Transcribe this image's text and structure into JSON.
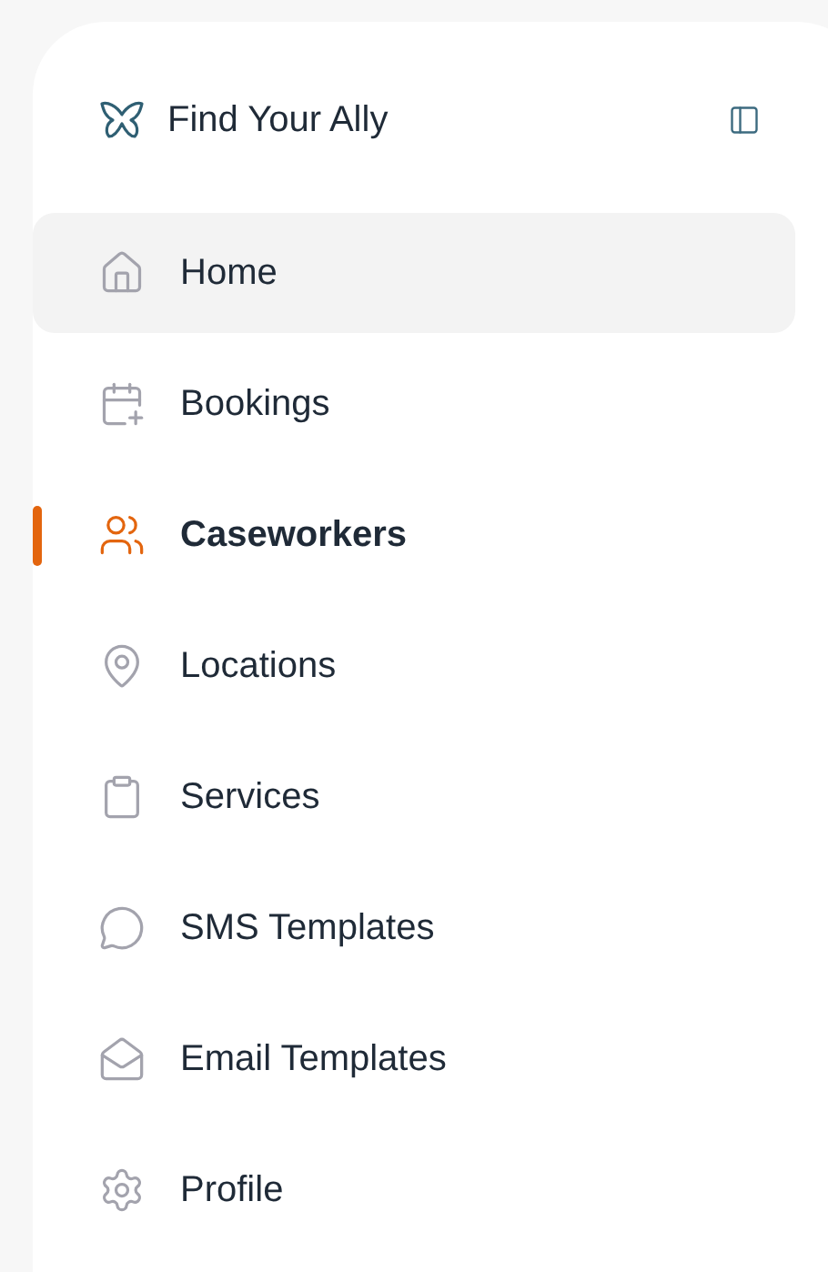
{
  "brand": {
    "title": "Find Your Ally"
  },
  "nav": [
    {
      "label": "Home",
      "selected": false,
      "hovered": true
    },
    {
      "label": "Bookings",
      "selected": false,
      "hovered": false
    },
    {
      "label": "Caseworkers",
      "selected": true,
      "hovered": false
    },
    {
      "label": "Locations",
      "selected": false,
      "hovered": false
    },
    {
      "label": "Services",
      "selected": false,
      "hovered": false
    },
    {
      "label": "SMS Templates",
      "selected": false,
      "hovered": false
    },
    {
      "label": "Email Templates",
      "selected": false,
      "hovered": false
    },
    {
      "label": "Profile",
      "selected": false,
      "hovered": false
    }
  ]
}
